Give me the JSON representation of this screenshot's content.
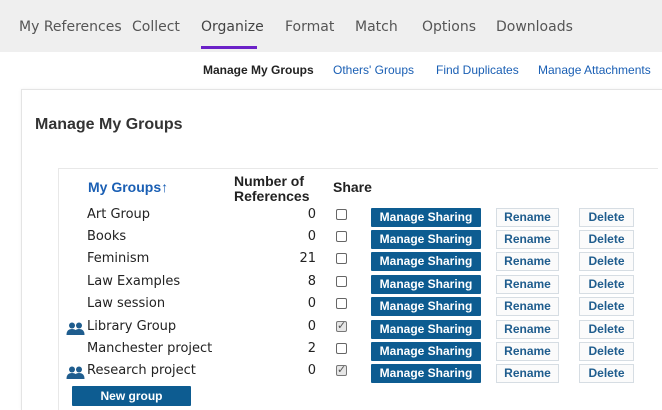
{
  "topnav": {
    "tabs": [
      {
        "label": "My References"
      },
      {
        "label": "Collect"
      },
      {
        "label": "Organize"
      },
      {
        "label": "Format"
      },
      {
        "label": "Match"
      },
      {
        "label": "Options"
      },
      {
        "label": "Downloads"
      }
    ],
    "active": "Organize",
    "accent_color": "#6b21c8"
  },
  "subnav": {
    "items": [
      {
        "label": "Manage My Groups"
      },
      {
        "label": "Others' Groups"
      },
      {
        "label": "Find Duplicates"
      },
      {
        "label": "Manage Attachments"
      }
    ],
    "current": "Manage My Groups"
  },
  "page": {
    "title": "Manage My Groups"
  },
  "table": {
    "headers": {
      "groups": "My Groups↑",
      "refs_line1": "Number of",
      "refs_line2": "References",
      "share": "Share"
    },
    "button_labels": {
      "share": "Manage Sharing",
      "rename": "Rename",
      "delete": "Delete"
    },
    "rows": [
      {
        "name": "Art Group",
        "count": "0",
        "shared": false,
        "icon": ""
      },
      {
        "name": "Books",
        "count": "0",
        "shared": false,
        "icon": ""
      },
      {
        "name": "Feminism",
        "count": "21",
        "shared": false,
        "icon": ""
      },
      {
        "name": "Law Examples",
        "count": "8",
        "shared": false,
        "icon": ""
      },
      {
        "name": "Law session",
        "count": "0",
        "shared": false,
        "icon": ""
      },
      {
        "name": "Library Group",
        "count": "0",
        "shared": true,
        "icon": "shared-group-icon"
      },
      {
        "name": "Manchester project",
        "count": "2",
        "shared": false,
        "icon": ""
      },
      {
        "name": "Research project",
        "count": "0",
        "shared": true,
        "icon": "shared-group-icon"
      }
    ]
  },
  "new_group_label": "New group",
  "colors": {
    "primary_button": "#0d5c91",
    "link": "#1a5fb4"
  }
}
